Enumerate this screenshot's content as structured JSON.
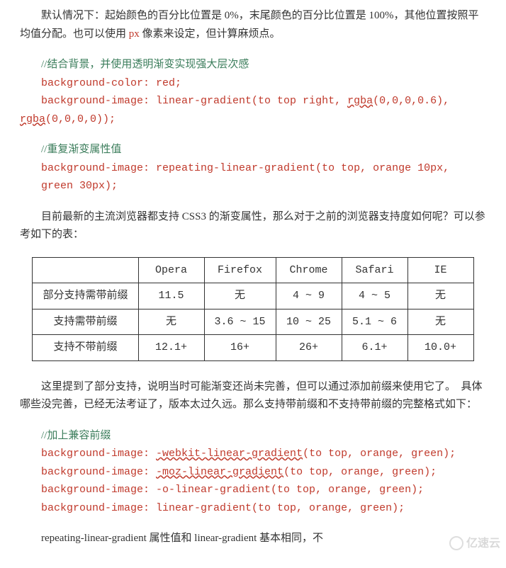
{
  "p1": {
    "pre": "默认情况下：起始颜色的百分比位置是 0%，末尾颜色的百分比位置是 100%，其他位置按照平均值分配。也可以使用 ",
    "px": "px",
    "post": " 像素来设定，但计算麻烦点。"
  },
  "code1": {
    "c1": "//结合背景，并使用透明渐变实现强大层次感",
    "l1": "background-color: red;",
    "l2a": "background-image:  linear-gradient(to  top  right,  ",
    "l2b": "rgba",
    "l2c": "(0,0,0,0.6), ",
    "l2d": "rgba",
    "l2e": "(0,0,0,0));"
  },
  "code2": {
    "c1": "//重复渐变属性值",
    "l1": "background-image: repeating-linear-gradient(to top, orange 10px, green 30px);"
  },
  "p2": "目前最新的主流浏览器都支持 CSS3 的渐变属性，那么对于之前的浏览器支持度如何呢？可以参考如下的表：",
  "table": {
    "head": [
      "",
      "Opera",
      "Firefox",
      "Chrome",
      "Safari",
      "IE"
    ],
    "rows": [
      [
        "部分支持需带前缀",
        "11.5",
        "无",
        "4 ~ 9",
        "4 ~ 5",
        "无"
      ],
      [
        "支持需带前缀",
        "无",
        "3.6 ~ 15",
        "10 ~ 25",
        "5.1 ~ 6",
        "无"
      ],
      [
        "支持不带前缀",
        "12.1+",
        "16+",
        "26+",
        "6.1+",
        "10.0+"
      ]
    ]
  },
  "p3": "这里提到了部分支持，说明当时可能渐变还尚未完善，但可以通过添加前缀来使用它了。　具体哪些没完善，已经无法考证了，版本太过久远。那么支持带前缀和不支持带前缀的完整格式如下：",
  "code3": {
    "c1": "//加上兼容前缀",
    "l1a": "background-image: ",
    "l1b": "-webkit-linear-gradient",
    "l1c": "(to top, orange, green);",
    "l2a": "background-image: ",
    "l2b": "-moz-linear-gradient",
    "l2c": "(to top, orange, green);",
    "l3": "background-image: -o-linear-gradient(to top, orange, green);",
    "l4": "background-image: linear-gradient(to top, orange, green);"
  },
  "p4": "repeating-linear-gradient 属性值和 linear-gradient 基本相同，不",
  "watermark": "亿速云"
}
